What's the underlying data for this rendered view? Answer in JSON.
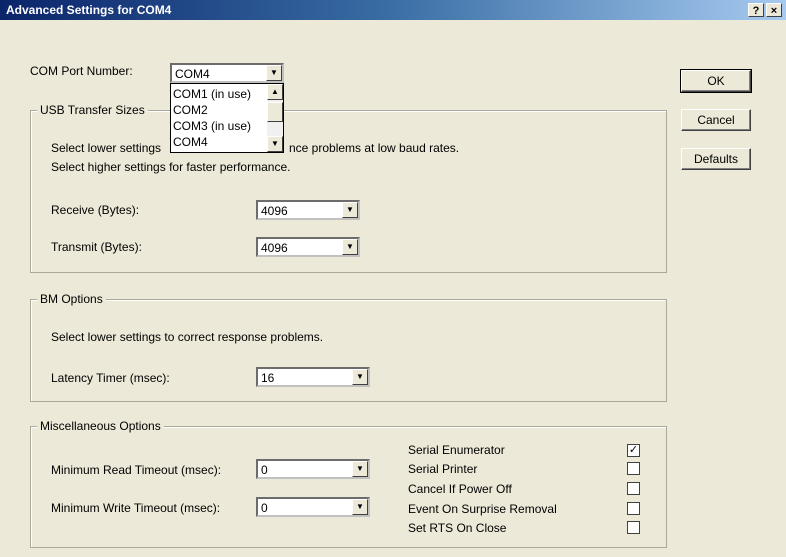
{
  "window": {
    "title": "Advanced Settings for COM4",
    "help_label": "?",
    "close_label": "×"
  },
  "com": {
    "label": "COM Port Number:",
    "value": "COM4",
    "options": [
      "COM1 (in use)",
      "COM2",
      "COM3 (in use)",
      "COM4"
    ]
  },
  "buttons": {
    "ok": "OK",
    "cancel": "Cancel",
    "defaults": "Defaults"
  },
  "usb": {
    "legend": "USB Transfer Sizes",
    "desc1_left": "Select lower settings",
    "desc1_right": "nce problems at low baud rates.",
    "desc2": "Select higher settings for faster performance.",
    "receive_label": "Receive (Bytes):",
    "receive_value": "4096",
    "transmit_label": "Transmit (Bytes):",
    "transmit_value": "4096"
  },
  "bm": {
    "legend": "BM Options",
    "desc": "Select lower settings to correct response problems.",
    "latency_label": "Latency Timer (msec):",
    "latency_value": "16"
  },
  "misc": {
    "legend": "Miscellaneous Options",
    "read_label": "Minimum Read Timeout (msec):",
    "read_value": "0",
    "write_label": "Minimum Write Timeout (msec):",
    "write_value": "0",
    "options": [
      {
        "label": "Serial Enumerator",
        "checked": true
      },
      {
        "label": "Serial Printer",
        "checked": false
      },
      {
        "label": "Cancel If Power Off",
        "checked": false
      },
      {
        "label": "Event On Surprise Removal",
        "checked": false
      },
      {
        "label": "Set RTS On Close",
        "checked": false
      }
    ]
  },
  "icons": {
    "dropdown_arrow": "▼",
    "scroll_up": "▲",
    "scroll_down": "▼",
    "check": "✓"
  }
}
